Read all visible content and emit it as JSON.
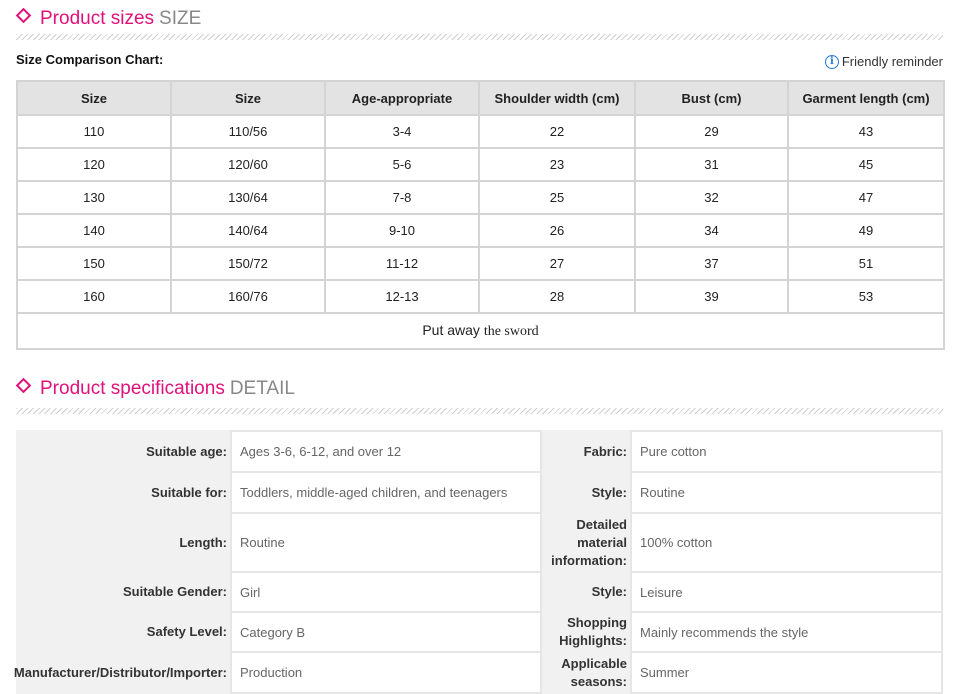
{
  "size_section": {
    "title": "Product sizes",
    "subtitle": "SIZE",
    "comparison_title": "Size Comparison Chart:",
    "reminder": "Friendly reminder",
    "columns": [
      "Size",
      "Size",
      "Age-appropriate",
      "Shoulder width (cm)",
      "Bust (cm)",
      "Garment length (cm)"
    ],
    "rows": [
      [
        "110",
        "110/56",
        "3-4",
        "22",
        "29",
        "43"
      ],
      [
        "120",
        "120/60",
        "5-6",
        "23",
        "31",
        "45"
      ],
      [
        "130",
        "130/64",
        "7-8",
        "25",
        "32",
        "47"
      ],
      [
        "140",
        "140/64",
        "9-10",
        "26",
        "34",
        "49"
      ],
      [
        "150",
        "150/72",
        "11-12",
        "27",
        "37",
        "51"
      ],
      [
        "160",
        "160/76",
        "12-13",
        "28",
        "39",
        "53"
      ]
    ],
    "footer_a": "Put away",
    "footer_b": "the  sword"
  },
  "detail_section": {
    "title": "Product specifications",
    "subtitle": "DETAIL",
    "rows": [
      {
        "left_label": "Suitable age:",
        "left_value": "Ages 3-6, 6-12, and over 12",
        "right_label": "Fabric:",
        "right_value": "Pure cotton"
      },
      {
        "left_label": "Suitable for:",
        "left_value": "Toddlers, middle-aged children, and teenagers",
        "right_label": "Style:",
        "right_value": "Routine"
      },
      {
        "left_label": "Length:",
        "left_value": "Routine",
        "right_label": "Detailed material information:",
        "right_value": "100% cotton"
      },
      {
        "left_label": "Suitable Gender:",
        "left_value": "Girl",
        "right_label": "Style:",
        "right_value": "Leisure"
      },
      {
        "left_label": "Safety Level:",
        "left_value": "Category B",
        "right_label": "Shopping Highlights:",
        "right_value": "Mainly recommends the style"
      },
      {
        "left_label": "Manufacturer/Distributor/Importer:",
        "left_value": "Production",
        "right_label": "Applicable seasons:",
        "right_value": "Summer"
      }
    ]
  },
  "colors": {
    "accent": "#e0117a",
    "header_bg": "#e3e3e3",
    "border": "#d4d4d4"
  },
  "icons": {
    "section_marker": "diamond-outline",
    "reminder": "info-circle"
  }
}
